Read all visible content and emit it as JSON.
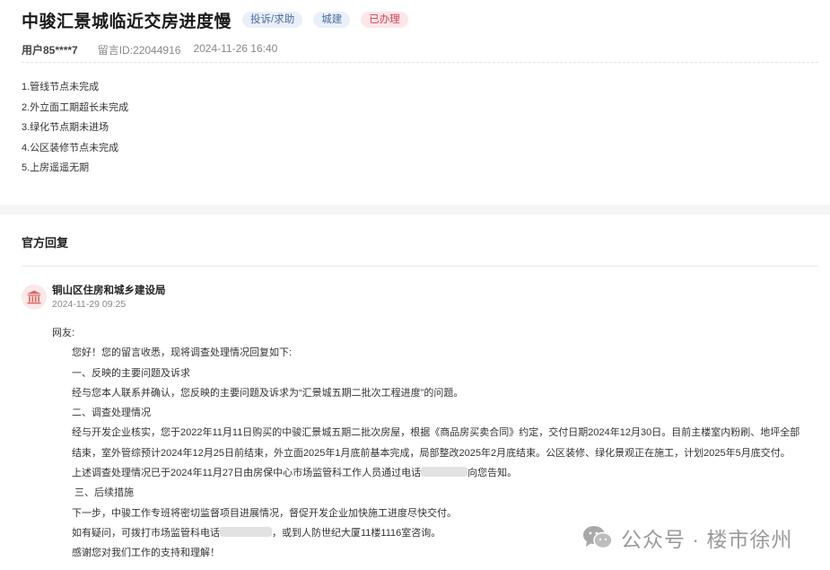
{
  "header": {
    "title": "中骏汇景城临近交房进度慢",
    "tags": [
      "投诉/求助",
      "城建",
      "已办理"
    ],
    "user": "用户85****7",
    "message_id": "留言ID:22044916",
    "timestamp": "2024-11-26 16:40"
  },
  "complaint_items": [
    "1.管线节点未完成",
    "2.外立面工期超长未完成",
    "3.绿化节点期未进场",
    "4.公区装修节点未完成",
    "5.上房遥遥无期"
  ],
  "reply": {
    "section_title": "官方回复",
    "org_name": "铜山区住房和城乡建设局",
    "reply_time": "2024-11-29 09:25",
    "greeting": "网友:",
    "p1": "您好！您的留言收悉，现将调查处理情况回复如下:",
    "p2": "一、反映的主要问题及诉求",
    "p3": "经与您本人联系并确认，您反映的主要问题及诉求为“汇景城五期二批次工程进度”的问题。",
    "p4": "二、调查处理情况",
    "p5": "经与开发企业核实，您于2022年11月11日购买的中骏汇景城五期二批次房屋，根据《商品房买卖合同》约定，交付日期2024年12月30日。目前主楼室内粉刷、地坪全部结束，室外管综预计2024年12月25日前结束，外立面2025年1月底前基本完成，局部整改2025年2月底结束。公区装修、绿化景观正在施工，计划2025年5月底交付。",
    "p6a": "上述调查处理情况已于2024年11月27日由房保中心市场监管科工作人员通过电话",
    "p6b": "向您告知。",
    "p7": "三、后续措施",
    "p8": "下一步，中骏工作专班将密切监督项目进展情况，督促开发企业加快施工进度尽快交付。",
    "p9a": "如有疑问，可拨打市场监管科电话",
    "p9b": "，或到人防世纪大厦11楼1116室咨询。",
    "p10": "感谢您对我们工作的支持和理解！"
  },
  "watermark": {
    "text": "公众号 · 楼市徐州",
    "icon": "wechat-icon"
  },
  "colors": {
    "tag_blue_bg": "#eaf0fa",
    "tag_red_bg": "#fde6ea",
    "tag_red_text": "#d5414d",
    "icon_red": "#d96b6b"
  }
}
